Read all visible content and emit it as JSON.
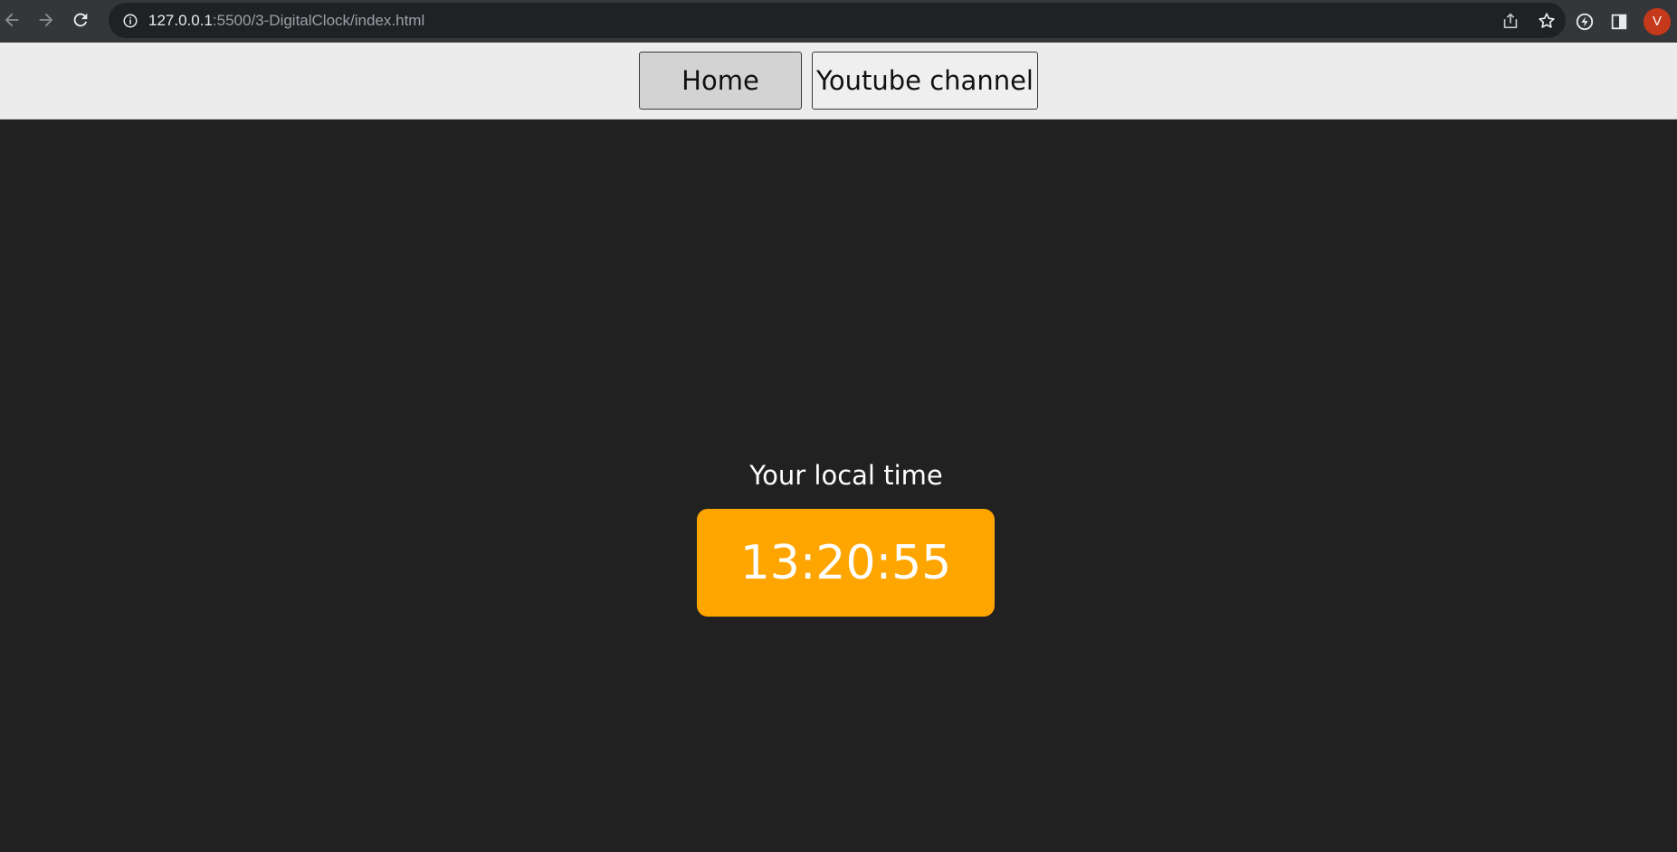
{
  "browser": {
    "url_host": "127.0.0.1",
    "url_rest": ":5500/3-DigitalClock/index.html",
    "profile_initial": "V",
    "icons": {
      "back": "arrow-left-icon",
      "forward": "arrow-right-icon",
      "reload": "reload-icon",
      "info": "info-icon",
      "share": "share-icon",
      "bookmark": "star-icon",
      "extension": "lightning-icon",
      "side_panel": "side-panel-icon"
    }
  },
  "nav": {
    "home_label": "Home",
    "youtube_label": "Youtube channel"
  },
  "clock": {
    "caption": "Your local time",
    "time": "13:20:55"
  },
  "colors": {
    "page_background": "#212121",
    "clock_background": "#ffa500",
    "nav_background": "#ececec",
    "avatar": "#c5391b"
  }
}
